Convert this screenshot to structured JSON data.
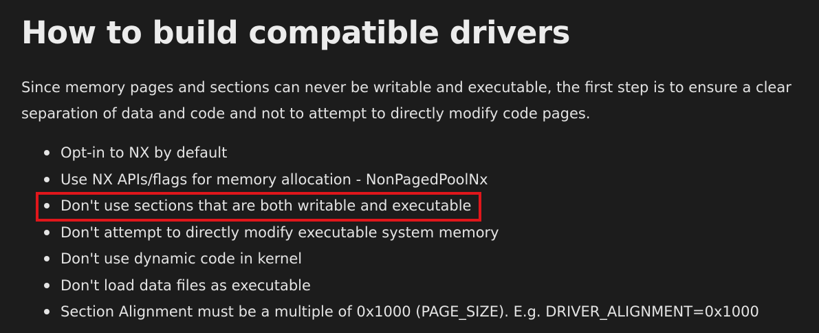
{
  "heading": "How to build compatible drivers",
  "intro": "Since memory pages and sections can never be writable and executable, the first step is to ensure a clear separation of data and code and not to attempt to directly modify code pages.",
  "bullets": [
    "Opt-in to NX by default",
    "Use NX APIs/flags for memory allocation - NonPagedPoolNx",
    "Don't use sections that are both writable and executable",
    "Don't attempt to directly modify executable system memory",
    "Don't use dynamic code in kernel",
    "Don't load data files as executable",
    "Section Alignment must be a multiple of 0x1000 (PAGE_SIZE). E.g. DRIVER_ALIGNMENT=0x1000"
  ],
  "highlight": {
    "bullet_index": 2,
    "color": "#e0161b"
  },
  "colors": {
    "background": "#1c1c1c",
    "text": "#e6e6e6"
  }
}
